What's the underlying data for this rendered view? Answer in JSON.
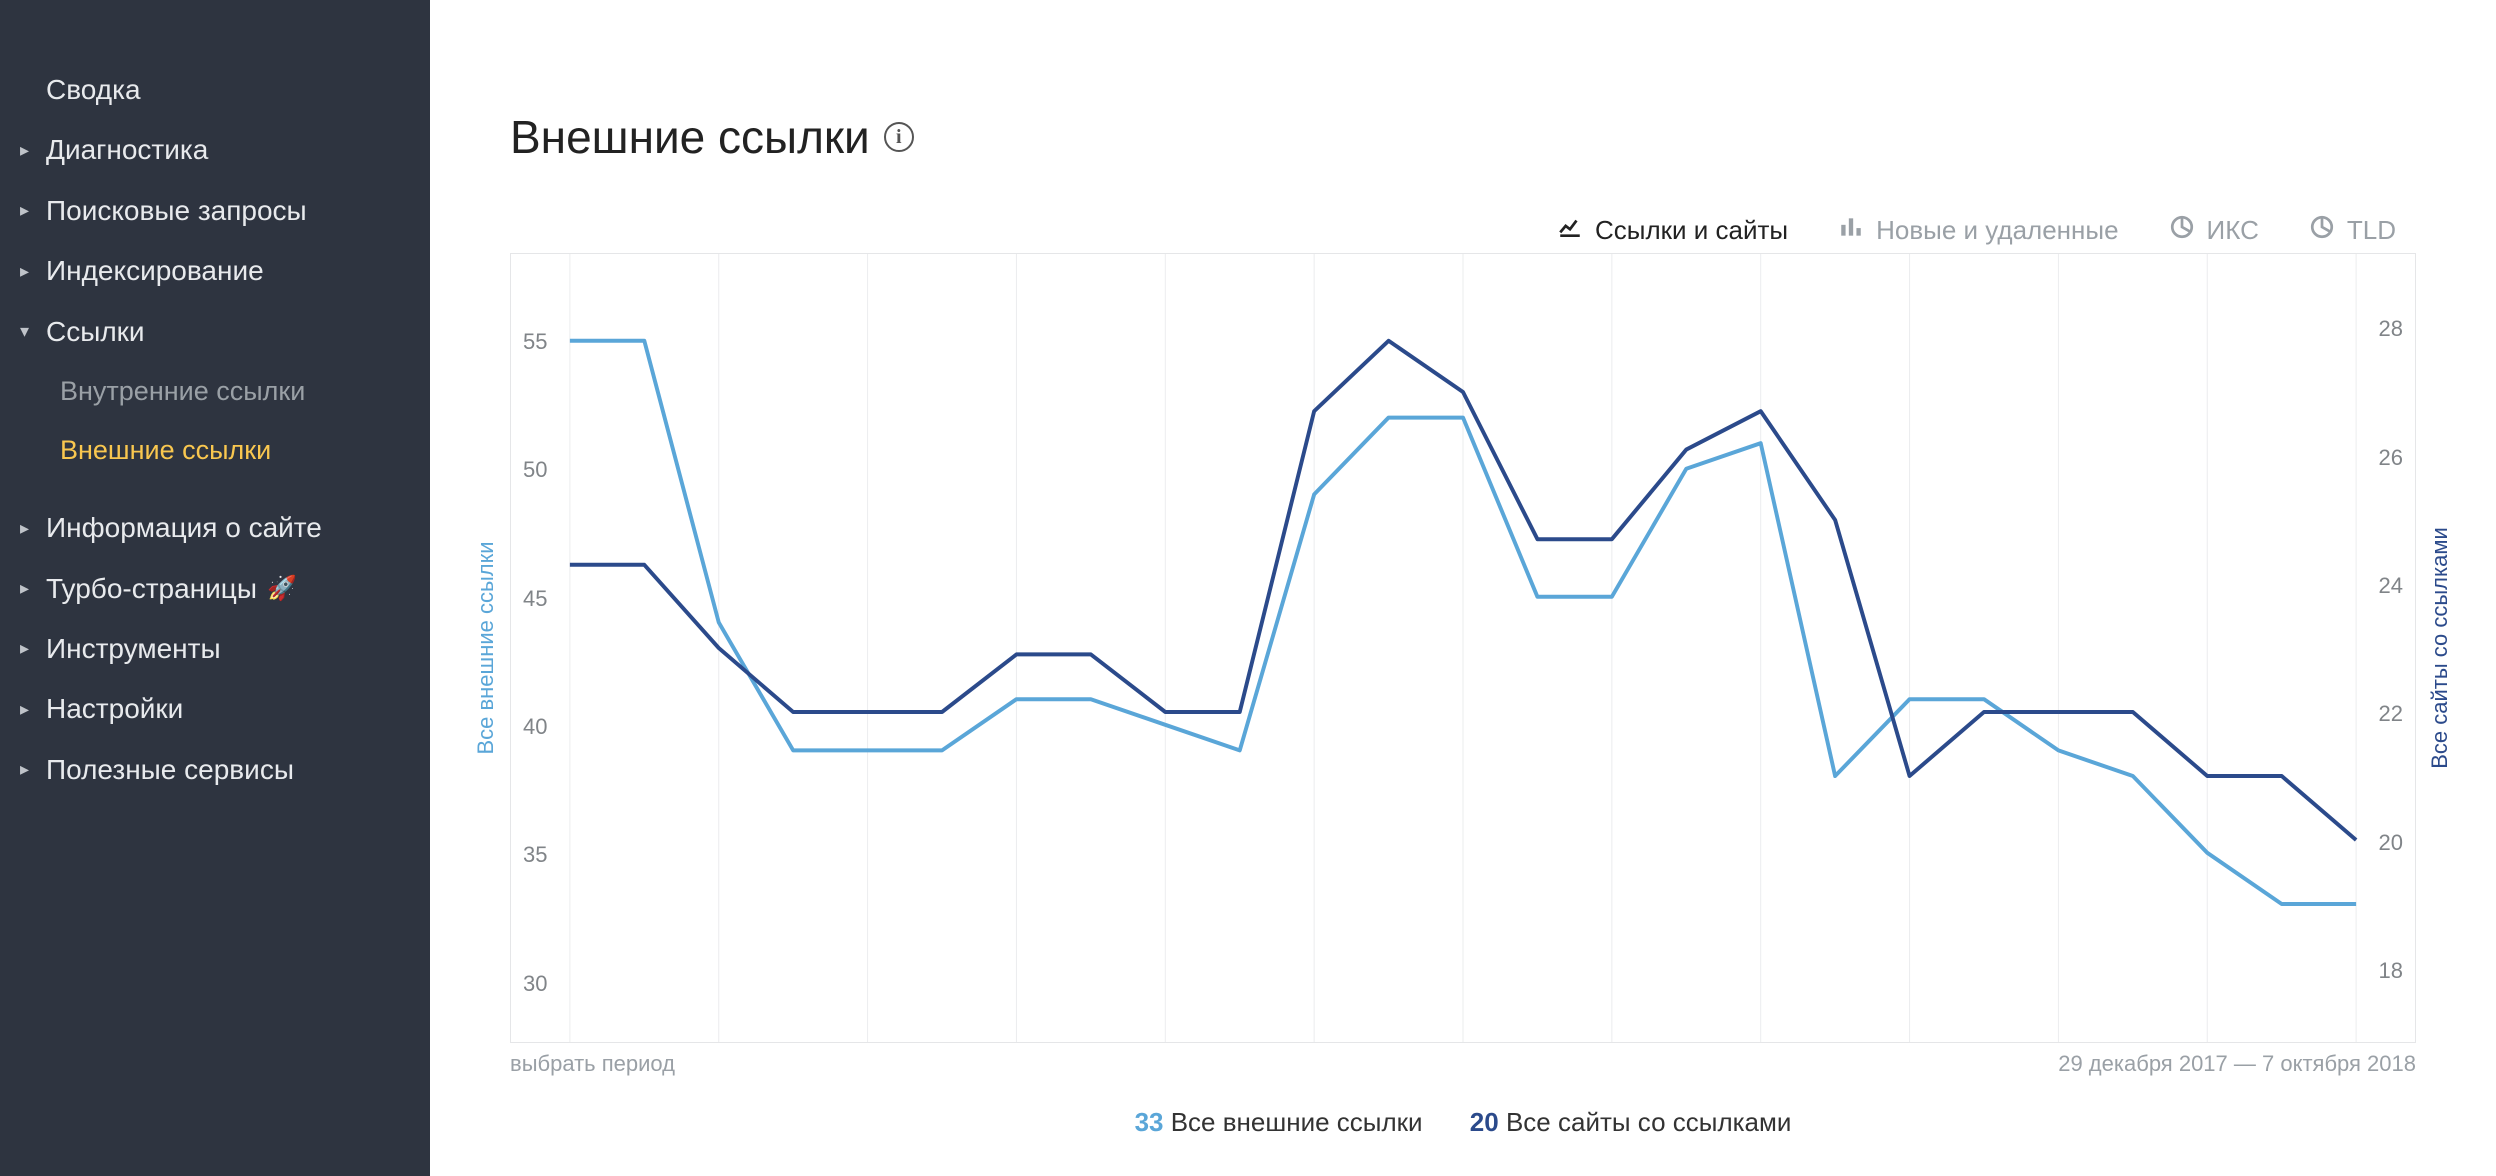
{
  "sidebar": {
    "items": [
      {
        "label": "Сводка",
        "caret": "none"
      },
      {
        "label": "Диагностика",
        "caret": "right"
      },
      {
        "label": "Поисковые запросы",
        "caret": "right"
      },
      {
        "label": "Индексирование",
        "caret": "right"
      },
      {
        "label": "Ссылки",
        "caret": "down",
        "sub": [
          {
            "label": "Внутренние ссылки",
            "active": false
          },
          {
            "label": "Внешние ссылки",
            "active": true
          }
        ]
      },
      {
        "label": "Информация о сайте",
        "caret": "right"
      },
      {
        "label": "Турбо-страницы",
        "caret": "right",
        "rocket": true
      },
      {
        "label": "Инструменты",
        "caret": "right"
      },
      {
        "label": "Настройки",
        "caret": "right"
      },
      {
        "label": "Полезные сервисы",
        "caret": "right"
      }
    ]
  },
  "header": {
    "title": "Внешние ссылки"
  },
  "tabs": [
    {
      "label": "Ссылки и сайты",
      "active": true,
      "icon": "line-chart-icon"
    },
    {
      "label": "Новые и удаленные",
      "active": false,
      "icon": "bar-chart-icon"
    },
    {
      "label": "ИКС",
      "active": false,
      "icon": "pie-chart-icon"
    },
    {
      "label": "TLD",
      "active": false,
      "icon": "pie-chart-icon"
    }
  ],
  "bottom": {
    "left": "выбрать период",
    "right": "29 декабря 2017 — 7 октября 2018"
  },
  "legend": {
    "series1_value": "33",
    "series1_label": "Все внешние ссылки",
    "series2_value": "20",
    "series2_label": "Все сайты со ссылками"
  },
  "axis_labels": {
    "left": "Все внешние ссылки",
    "right": "Все сайты со ссылками"
  },
  "chart_data": {
    "type": "line",
    "series": [
      {
        "name": "Все внешние ссылки",
        "axis": "left",
        "color": "#5aa6d8",
        "values": [
          55,
          55,
          44,
          39,
          39,
          39,
          41,
          41,
          40,
          39,
          49,
          52,
          52,
          45,
          45,
          50,
          51,
          38,
          41,
          41,
          39,
          38,
          35,
          33,
          33
        ]
      },
      {
        "name": "Все сайты со ссылками",
        "axis": "right",
        "color": "#2b4a8b",
        "values": [
          24.3,
          24.3,
          23,
          22,
          22,
          22,
          22.9,
          22.9,
          22,
          22,
          26.7,
          27.8,
          27.0,
          24.7,
          24.7,
          26.1,
          26.7,
          25,
          21,
          22,
          22,
          22,
          21,
          21,
          20
        ]
      }
    ],
    "y_left": {
      "min": 28,
      "max": 58,
      "ticks": [
        30,
        35,
        40,
        45,
        50,
        55
      ]
    },
    "y_right": {
      "min": 17,
      "max": 29,
      "ticks": [
        18,
        20,
        22,
        24,
        26,
        28
      ]
    },
    "grid_columns": 12,
    "xlabel": "",
    "ylabel_left": "Все внешние ссылки",
    "ylabel_right": "Все сайты со ссылками",
    "title": ""
  }
}
